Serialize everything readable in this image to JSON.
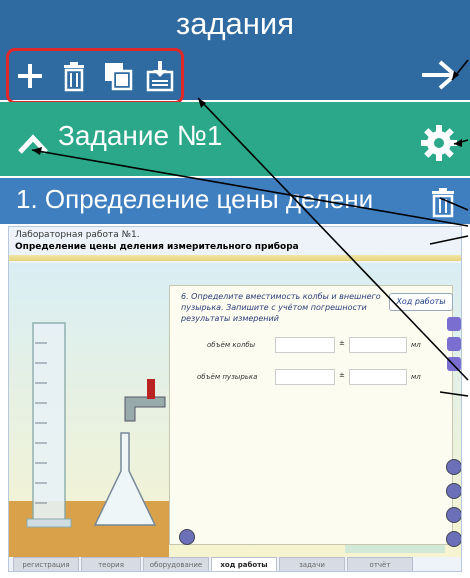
{
  "header": {
    "title": "задания",
    "toolbar_icons": [
      "plus-icon",
      "trash-icon",
      "copy-icon",
      "save-icon"
    ],
    "next_icon": "arrow-right-icon"
  },
  "task": {
    "title": "Задание №1",
    "collapse_icon": "chevron-up-icon",
    "settings_icon": "gear-icon"
  },
  "item": {
    "title": "1. Определение цены делени",
    "delete_icon": "trash-icon"
  },
  "lab": {
    "line1": "Лабораторная работа №1.",
    "line2": "Определение цены деления измерительного прибора",
    "hod_button": "Ход работы",
    "question": "6. Определите вместимость колбы и внешнего пузырька. Запишите с учётом погрешности результаты измерений",
    "field1_label": "объём колбы",
    "field2_label": "объём пузырька",
    "pm": "±",
    "unit": "мл",
    "scale": [
      "60",
      "40",
      "20"
    ],
    "tabs": [
      "регистрация",
      "теория",
      "оборудование",
      "ход работы",
      "задачи",
      "отчёт"
    ],
    "active_tab": "ход работы"
  },
  "colors": {
    "header_blue": "#2f6aa0",
    "task_green": "#2aa889",
    "item_blue": "#3f7fc0",
    "highlight_red": "#e0282a"
  }
}
